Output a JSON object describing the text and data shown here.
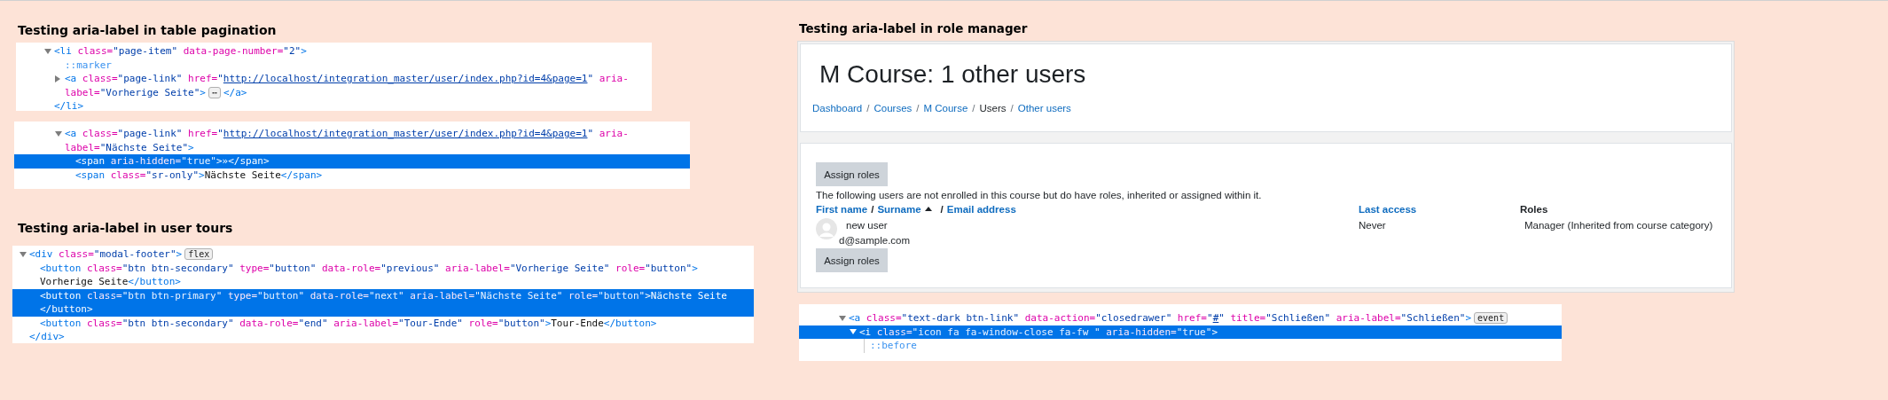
{
  "left_sections": [
    {
      "title": "Testing aria-label in table pagination",
      "panels": [
        {
          "nodes": [
            {
              "kind": "node",
              "expanded": true,
              "selected": false,
              "lines": [
                [
                  {
                    "kind": "tag",
                    "text": "<li"
                  },
                  {
                    "kind": "attr",
                    "text": " class="
                  },
                  {
                    "kind": "value",
                    "text": "\"page-item\""
                  },
                  {
                    "kind": "attr",
                    "text": " data-page-number="
                  },
                  {
                    "kind": "value",
                    "text": "\"2\""
                  },
                  {
                    "kind": "tag",
                    "text": ">"
                  }
                ]
              ],
              "children": [
                {
                  "kind": "leaf",
                  "selected": false,
                  "lines": [
                    [
                      {
                        "kind": "pseudo",
                        "text": "::marker"
                      }
                    ]
                  ]
                },
                {
                  "kind": "node",
                  "expanded": false,
                  "selected": false,
                  "lines": [
                    [
                      {
                        "kind": "tag",
                        "text": "<a"
                      },
                      {
                        "kind": "attr",
                        "text": " class="
                      },
                      {
                        "kind": "value",
                        "text": "\"page-link\""
                      },
                      {
                        "kind": "attr",
                        "text": " href="
                      },
                      {
                        "kind": "value",
                        "text": "\""
                      },
                      {
                        "kind": "url",
                        "text": "http://localhost/integration_master/user/index.php?id=4&page=1"
                      },
                      {
                        "kind": "value",
                        "text": "\""
                      },
                      {
                        "kind": "attr",
                        "text": " aria-"
                      }
                    ],
                    [
                      {
                        "kind": "attr",
                        "text": "label="
                      },
                      {
                        "kind": "value",
                        "text": "\"Vorherige Seite\""
                      },
                      {
                        "kind": "tag",
                        "text": ">"
                      },
                      {
                        "kind": "badge",
                        "text": "⋯"
                      },
                      {
                        "kind": "tag",
                        "text": "</a>"
                      }
                    ]
                  ]
                }
              ]
            },
            {
              "kind": "leaf",
              "selected": false,
              "lines": [
                [
                  {
                    "kind": "tag",
                    "text": "</li>"
                  }
                ]
              ]
            }
          ]
        },
        {
          "nodes": [
            {
              "kind": "node",
              "expanded": true,
              "selected": false,
              "lines": [
                [
                  {
                    "kind": "tag",
                    "text": "<a"
                  },
                  {
                    "kind": "attr",
                    "text": " class="
                  },
                  {
                    "kind": "value",
                    "text": "\"page-link\""
                  },
                  {
                    "kind": "attr",
                    "text": " href="
                  },
                  {
                    "kind": "value",
                    "text": "\""
                  },
                  {
                    "kind": "url",
                    "text": "http://localhost/integration_master/user/index.php?id=4&page=1"
                  },
                  {
                    "kind": "value",
                    "text": "\""
                  },
                  {
                    "kind": "attr",
                    "text": " aria-"
                  }
                ],
                [
                  {
                    "kind": "attr",
                    "text": "label="
                  },
                  {
                    "kind": "value",
                    "text": "\"Nächste Seite\""
                  },
                  {
                    "kind": "tag",
                    "text": ">"
                  }
                ]
              ],
              "children": [
                {
                  "kind": "leaf",
                  "selected": true,
                  "lines": [
                    [
                      {
                        "kind": "tag",
                        "text": "<span"
                      },
                      {
                        "kind": "attr",
                        "text": " aria-hidden="
                      },
                      {
                        "kind": "value",
                        "text": "\"true\""
                      },
                      {
                        "kind": "tag",
                        "text": ">"
                      },
                      {
                        "kind": "text",
                        "text": "»"
                      },
                      {
                        "kind": "tag",
                        "text": "</span>"
                      }
                    ]
                  ]
                },
                {
                  "kind": "leaf",
                  "selected": false,
                  "lines": [
                    [
                      {
                        "kind": "tag",
                        "text": "<span"
                      },
                      {
                        "kind": "attr",
                        "text": " class="
                      },
                      {
                        "kind": "value",
                        "text": "\"sr-only\""
                      },
                      {
                        "kind": "tag",
                        "text": ">"
                      },
                      {
                        "kind": "text",
                        "text": "Nächste Seite"
                      },
                      {
                        "kind": "tag",
                        "text": "</span>"
                      }
                    ]
                  ]
                }
              ]
            }
          ]
        }
      ]
    },
    {
      "title": "Testing aria-label in user tours",
      "panels": [
        {
          "nodes": [
            {
              "kind": "node",
              "expanded": true,
              "selected": false,
              "lines": [
                [
                  {
                    "kind": "tag",
                    "text": "<div"
                  },
                  {
                    "kind": "attr",
                    "text": " class="
                  },
                  {
                    "kind": "value",
                    "text": "\"modal-footer\""
                  },
                  {
                    "kind": "tag",
                    "text": ">"
                  },
                  {
                    "kind": "badge",
                    "text": "flex"
                  }
                ]
              ],
              "children": [
                {
                  "kind": "leaf",
                  "selected": false,
                  "lines": [
                    [
                      {
                        "kind": "tag",
                        "text": "<button"
                      },
                      {
                        "kind": "attr",
                        "text": " class="
                      },
                      {
                        "kind": "value",
                        "text": "\"btn btn-secondary\""
                      },
                      {
                        "kind": "attr",
                        "text": " type="
                      },
                      {
                        "kind": "value",
                        "text": "\"button\""
                      },
                      {
                        "kind": "attr",
                        "text": " data-role="
                      },
                      {
                        "kind": "value",
                        "text": "\"previous\""
                      },
                      {
                        "kind": "attr",
                        "text": " aria-label="
                      },
                      {
                        "kind": "value",
                        "text": "\"Vorherige Seite\""
                      },
                      {
                        "kind": "attr",
                        "text": " role="
                      },
                      {
                        "kind": "value",
                        "text": "\"button\""
                      },
                      {
                        "kind": "tag",
                        "text": ">"
                      }
                    ],
                    [
                      {
                        "kind": "text",
                        "text": "Vorherige Seite"
                      },
                      {
                        "kind": "tag",
                        "text": "</button>"
                      }
                    ]
                  ]
                },
                {
                  "kind": "leaf",
                  "selected": true,
                  "lines": [
                    [
                      {
                        "kind": "tag",
                        "text": "<button"
                      },
                      {
                        "kind": "attr",
                        "text": " class="
                      },
                      {
                        "kind": "value",
                        "text": "\"btn btn-primary\""
                      },
                      {
                        "kind": "attr",
                        "text": " type="
                      },
                      {
                        "kind": "value",
                        "text": "\"button\""
                      },
                      {
                        "kind": "attr",
                        "text": " data-role="
                      },
                      {
                        "kind": "value",
                        "text": "\"next\""
                      },
                      {
                        "kind": "attr",
                        "text": " aria-label="
                      },
                      {
                        "kind": "value",
                        "text": "\"Nächste Seite\""
                      },
                      {
                        "kind": "attr",
                        "text": " role="
                      },
                      {
                        "kind": "value",
                        "text": "\"button\""
                      },
                      {
                        "kind": "tag",
                        "text": ">"
                      },
                      {
                        "kind": "text",
                        "text": "Nächste Seite"
                      }
                    ],
                    [
                      {
                        "kind": "tag",
                        "text": "</button>"
                      }
                    ]
                  ]
                },
                {
                  "kind": "leaf",
                  "selected": false,
                  "lines": [
                    [
                      {
                        "kind": "tag",
                        "text": "<button"
                      },
                      {
                        "kind": "attr",
                        "text": " class="
                      },
                      {
                        "kind": "value",
                        "text": "\"btn btn-secondary\""
                      },
                      {
                        "kind": "attr",
                        "text": " data-role="
                      },
                      {
                        "kind": "value",
                        "text": "\"end\""
                      },
                      {
                        "kind": "attr",
                        "text": " aria-label="
                      },
                      {
                        "kind": "value",
                        "text": "\"Tour-Ende\""
                      },
                      {
                        "kind": "attr",
                        "text": " role="
                      },
                      {
                        "kind": "value",
                        "text": "\"button\""
                      },
                      {
                        "kind": "tag",
                        "text": ">"
                      },
                      {
                        "kind": "text",
                        "text": "Tour-Ende"
                      },
                      {
                        "kind": "tag",
                        "text": "</button>"
                      }
                    ]
                  ]
                }
              ]
            },
            {
              "kind": "leaf",
              "selected": false,
              "lines": [
                [
                  {
                    "kind": "tag",
                    "text": "</div>"
                  }
                ]
              ]
            }
          ]
        }
      ]
    }
  ],
  "role_manager": {
    "title": "Testing aria-label in role manager",
    "page": {
      "heading": "M Course: 1 other users",
      "breadcrumb": {
        "separator": "/",
        "items": [
          {
            "label": "Dashboard",
            "link": true
          },
          {
            "label": "Courses",
            "link": true
          },
          {
            "label": "M Course",
            "link": true
          },
          {
            "label": "Users",
            "link": false
          },
          {
            "label": "Other users",
            "link": true
          }
        ]
      },
      "top_button": "Assign roles",
      "description": "The following users are not enrolled in this course but do have roles, inherited or assigned within it.",
      "table": {
        "name_header": {
          "separator": "/",
          "items": [
            {
              "label": "First name",
              "sorted": false
            },
            {
              "label": "Surname",
              "sorted": true
            },
            {
              "label": "Email address",
              "sorted": false
            }
          ]
        },
        "columns": [
          {
            "label": "Last access",
            "link": true
          },
          {
            "label": "Roles",
            "link": false
          }
        ],
        "rows": [
          {
            "name": "new user",
            "email": "d@sample.com",
            "last_access": "Never",
            "roles": "Manager (Inherited from course category)"
          }
        ]
      },
      "bottom_button": "Assign roles"
    },
    "panel": {
      "nodes": [
        {
          "kind": "node",
          "expanded": true,
          "selected": false,
          "lines": [
            [
              {
                "kind": "tag",
                "text": "<a"
              },
              {
                "kind": "attr",
                "text": " class="
              },
              {
                "kind": "value",
                "text": "\"text-dark btn-link\""
              },
              {
                "kind": "attr",
                "text": " data-action="
              },
              {
                "kind": "value",
                "text": "\"closedrawer\""
              },
              {
                "kind": "attr",
                "text": " href="
              },
              {
                "kind": "value",
                "text": "\""
              },
              {
                "kind": "url",
                "text": "#"
              },
              {
                "kind": "value",
                "text": "\""
              },
              {
                "kind": "attr",
                "text": " title="
              },
              {
                "kind": "value",
                "text": "\"Schließen\""
              },
              {
                "kind": "attr",
                "text": " aria-label="
              },
              {
                "kind": "value",
                "text": "\"Schließen\""
              },
              {
                "kind": "tag",
                "text": ">"
              },
              {
                "kind": "badge",
                "text": "event"
              }
            ]
          ],
          "children": [
            {
              "kind": "node",
              "expanded": true,
              "selected": true,
              "lines": [
                [
                  {
                    "kind": "tag",
                    "text": "<i"
                  },
                  {
                    "kind": "attr",
                    "text": " class="
                  },
                  {
                    "kind": "value",
                    "text": "\"icon fa fa-window-close fa-fw \""
                  },
                  {
                    "kind": "attr",
                    "text": " aria-hidden="
                  },
                  {
                    "kind": "value",
                    "text": "\"true\""
                  },
                  {
                    "kind": "tag",
                    "text": ">"
                  }
                ]
              ],
              "children": [
                {
                  "kind": "leaf",
                  "selected": false,
                  "lines": [
                    [
                      {
                        "kind": "pseudo",
                        "text": "::before"
                      }
                    ]
                  ]
                }
              ]
            }
          ]
        }
      ]
    }
  }
}
